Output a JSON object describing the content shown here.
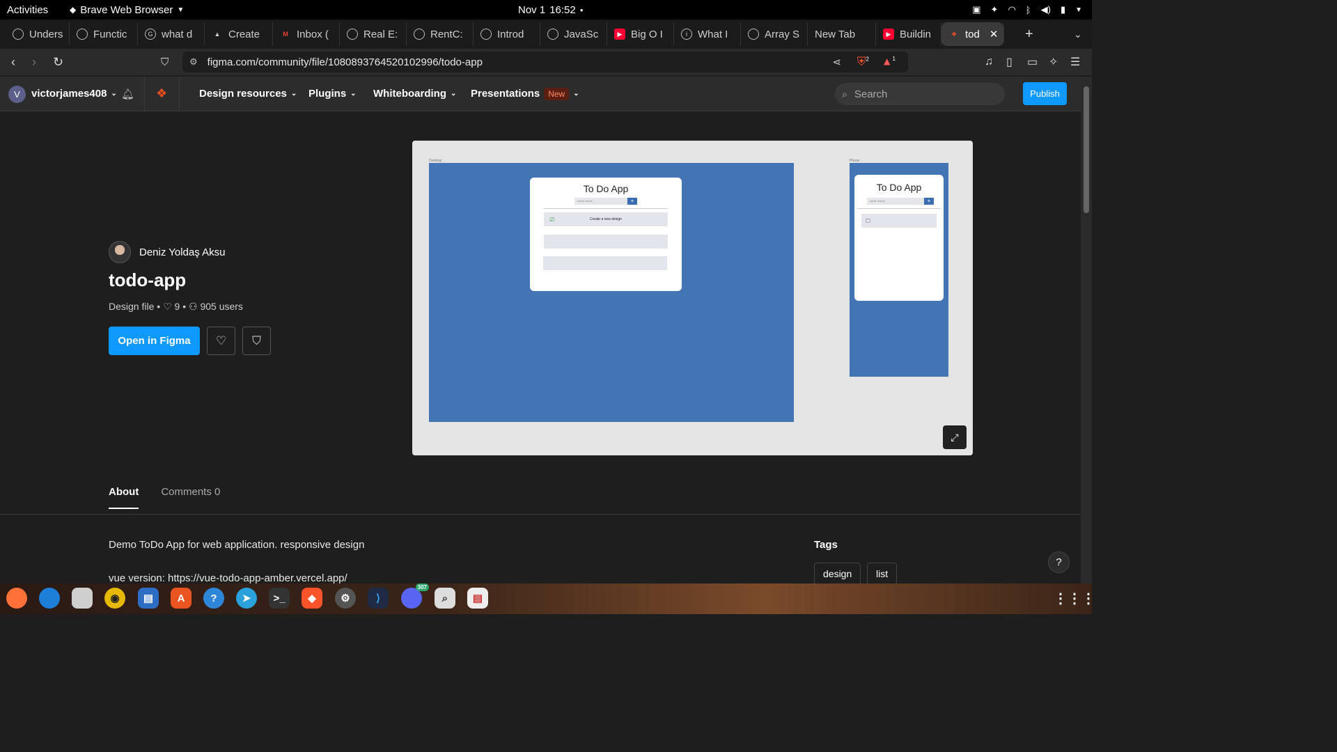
{
  "system": {
    "activities": "Activities",
    "app_name": "Brave Web Browser",
    "date": "Nov 1",
    "time": "16:52"
  },
  "browser": {
    "tabs": [
      {
        "label": "Unders",
        "icon": "generic-icon"
      },
      {
        "label": "Functic",
        "icon": "generic-icon"
      },
      {
        "label": "what d",
        "icon": "google-icon"
      },
      {
        "label": "Create",
        "icon": "generic-icon"
      },
      {
        "label": "Inbox (",
        "icon": "gmail-icon"
      },
      {
        "label": "Real E:",
        "icon": "generic-icon"
      },
      {
        "label": "RentC:",
        "icon": "generic-icon"
      },
      {
        "label": "Introd",
        "icon": "generic-icon"
      },
      {
        "label": "JavaSc",
        "icon": "generic-icon"
      },
      {
        "label": "Big O I",
        "icon": "youtube-icon"
      },
      {
        "label": "What I",
        "icon": "generic-icon"
      },
      {
        "label": "Array S",
        "icon": "generic-icon"
      },
      {
        "label": "New Tab",
        "icon": "none"
      },
      {
        "label": "Buildin",
        "icon": "youtube-icon"
      },
      {
        "label": "tod",
        "icon": "figma-icon"
      }
    ],
    "url": "figma.com/community/file/1080893764520102996/todo-app",
    "brave_shield_count": "2",
    "rewards_count": "1"
  },
  "figma_header": {
    "user_initial": "V",
    "username": "victorjames408",
    "menu": [
      "Design resources",
      "Plugins",
      "Whiteboarding",
      "Presentations"
    ],
    "new_badge": "New",
    "search_placeholder": "Search",
    "publish_label": "Publish"
  },
  "file": {
    "author": "Deniz Yoldaş Aksu",
    "title": "todo-app",
    "type": "Design file",
    "likes": "9",
    "users": "905 users",
    "open_label": "Open in Figma"
  },
  "preview": {
    "desktop_label": "Desktop",
    "phone_label": "Phone",
    "app_title": "To Do App",
    "input_placeholder": "some words",
    "add_symbol": "+",
    "task_text": "Create a new design"
  },
  "tabs": {
    "about": "About",
    "comments": "Comments",
    "comments_count": "0"
  },
  "about": {
    "description": "Demo ToDo App for web application. responsive design",
    "vue_line": "vue version: https://vue-todo-app-amber.vercel.app/"
  },
  "tags": {
    "heading": "Tags",
    "items": [
      "design",
      "list"
    ]
  },
  "dock": {
    "discord_badge": "307"
  },
  "colors": {
    "accent": "#0d99ff",
    "frame_blue": "#4374b3"
  }
}
